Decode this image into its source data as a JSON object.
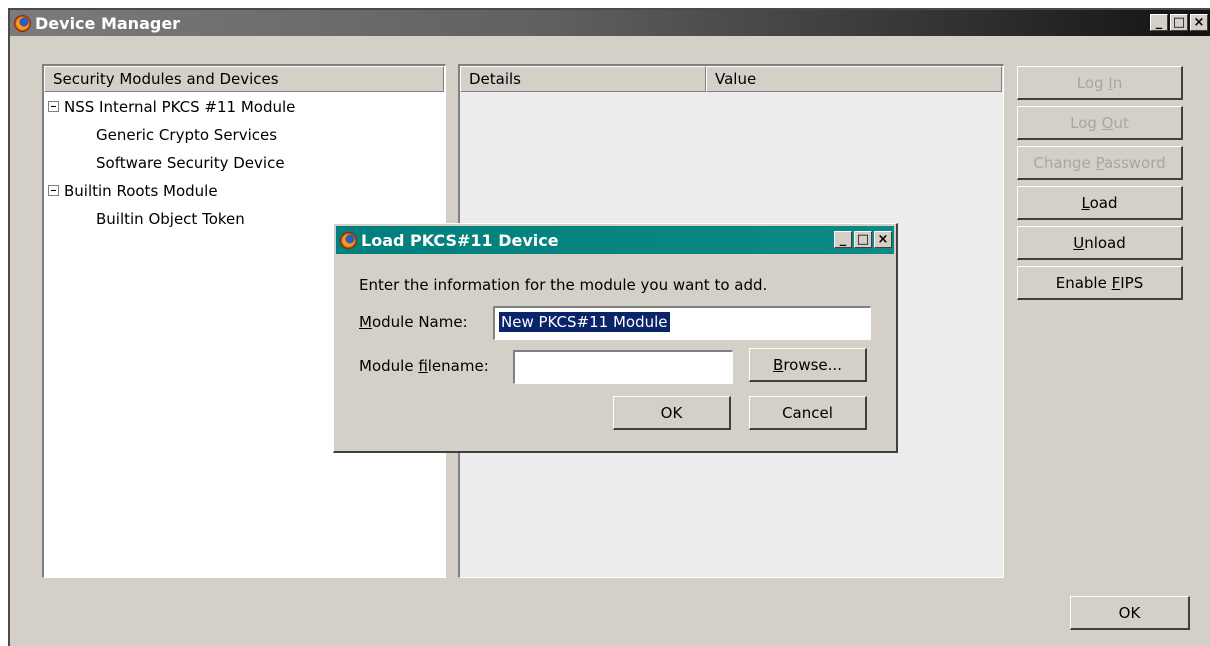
{
  "window": {
    "title": "Device Manager",
    "controls": [
      "_",
      "□",
      "×"
    ]
  },
  "tree": {
    "header": "Security Modules and Devices",
    "items": [
      {
        "label": "NSS Internal PKCS #11 Module",
        "level": 0,
        "expanded": true
      },
      {
        "label": "Generic Crypto Services",
        "level": 1
      },
      {
        "label": "Software Security Device",
        "level": 1
      },
      {
        "label": "Builtin Roots Module",
        "level": 0,
        "expanded": true
      },
      {
        "label": "Builtin Object Token",
        "level": 1
      }
    ]
  },
  "details": {
    "col_details": "Details",
    "col_value": "Value"
  },
  "buttons": {
    "login": {
      "pre": "Log ",
      "key": "I",
      "post": "n"
    },
    "logout": {
      "pre": "Log ",
      "key": "O",
      "post": "ut"
    },
    "change_password": {
      "pre": "Change ",
      "key": "P",
      "post": "assword"
    },
    "load": {
      "pre": "",
      "key": "L",
      "post": "oad"
    },
    "unload": {
      "pre": "",
      "key": "U",
      "post": "nload"
    },
    "enable_fips": {
      "pre": "Enable ",
      "key": "F",
      "post": "IPS"
    },
    "ok": "OK"
  },
  "dialog": {
    "title": "Load PKCS#11 Device",
    "controls": [
      "_",
      "□",
      "×"
    ],
    "instruction": "Enter the information for the module you want to add.",
    "module_name_label": {
      "pre": "",
      "key": "M",
      "post": "odule Name:"
    },
    "module_name_value": "New PKCS#11 Module",
    "module_filename_label": {
      "pre": "Module ",
      "key": "f",
      "post": "ilename:"
    },
    "module_filename_value": "",
    "browse": {
      "pre": "",
      "key": "B",
      "post": "rowse..."
    },
    "ok": "OK",
    "cancel": "Cancel"
  },
  "colors": {
    "face": "#d4d0c8",
    "main_title_start": "#7b7b7b",
    "dialog_title": "#007f7c",
    "selection": "#0a246a",
    "disabled_text": "#a8a6a0"
  }
}
